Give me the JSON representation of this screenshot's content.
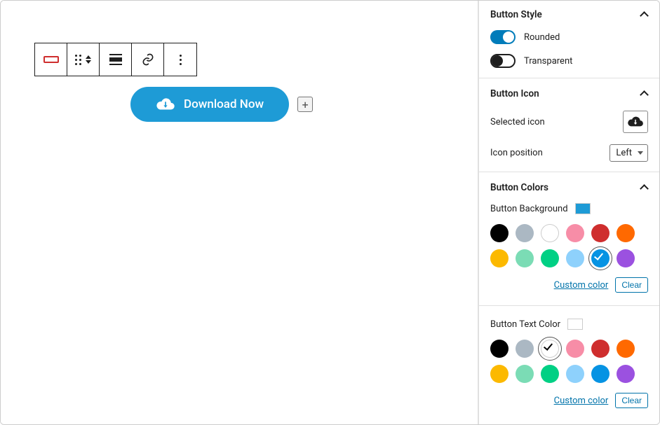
{
  "toolbar": {
    "block_type": "button-block",
    "move": "move",
    "align": "align",
    "link": "link",
    "more": "more"
  },
  "button": {
    "label": "Download Now",
    "icon": "cloud-download",
    "add_block": "+"
  },
  "sidebar": {
    "style": {
      "title": "Button Style",
      "rounded": {
        "label": "Rounded",
        "value": true
      },
      "transparent": {
        "label": "Transparent",
        "value": false
      }
    },
    "icon": {
      "title": "Button Icon",
      "selected_label": "Selected icon",
      "selected_icon": "cloud-download",
      "position_label": "Icon position",
      "position_value": "Left"
    },
    "colors": {
      "title": "Button Colors",
      "background": {
        "label": "Button Background",
        "current": "#1e9bd6",
        "selected_index": 10,
        "palette": [
          "#000000",
          "#abb8c3",
          "#ffffff",
          "#f78da7",
          "#cf2e2e",
          "#ff6900",
          "#fcb900",
          "#7bdcb5",
          "#00d084",
          "#8ed1fc",
          "#0693e3",
          "#9b51e0"
        ],
        "custom_label": "Custom color",
        "clear_label": "Clear"
      },
      "text": {
        "label": "Button Text Color",
        "current": "#ffffff",
        "selected_index": 2,
        "palette": [
          "#000000",
          "#abb8c3",
          "#ffffff",
          "#f78da7",
          "#cf2e2e",
          "#ff6900",
          "#fcb900",
          "#7bdcb5",
          "#00d084",
          "#8ed1fc",
          "#0693e3",
          "#9b51e0"
        ],
        "custom_label": "Custom color",
        "clear_label": "Clear"
      }
    }
  }
}
